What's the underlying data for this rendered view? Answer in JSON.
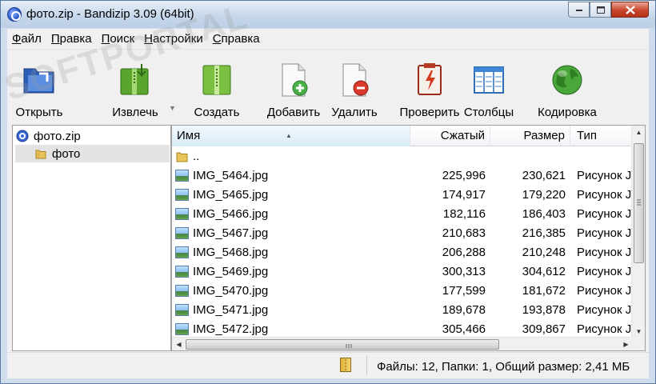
{
  "window": {
    "title": "фото.zip - Bandizip 3.09 (64bit)"
  },
  "menu": [
    "Файл",
    "Правка",
    "Поиск",
    "Настройки",
    "Справка"
  ],
  "toolbar": [
    {
      "label": "Открыть",
      "icon": "open-icon"
    },
    {
      "label": "Извлечь",
      "icon": "extract-icon"
    },
    {
      "label": "Создать",
      "icon": "create-icon"
    },
    {
      "label": "Добавить",
      "icon": "add-icon"
    },
    {
      "label": "Удалить",
      "icon": "delete-icon"
    },
    {
      "label": "Проверить",
      "icon": "test-icon"
    },
    {
      "label": "Столбцы",
      "icon": "columns-icon"
    },
    {
      "label": "Кодировка",
      "icon": "encoding-icon"
    }
  ],
  "tree": [
    {
      "label": "фото.zip",
      "icon": "archive-icon"
    },
    {
      "label": "фото",
      "icon": "folder-icon"
    }
  ],
  "columns": [
    "Имя",
    "Сжатый",
    "Размер",
    "Тип"
  ],
  "files": [
    {
      "name": "..",
      "compressed": "",
      "size": "",
      "type": ""
    },
    {
      "name": "IMG_5464.jpg",
      "compressed": "225,996",
      "size": "230,621",
      "type": "Рисунок JI"
    },
    {
      "name": "IMG_5465.jpg",
      "compressed": "174,917",
      "size": "179,220",
      "type": "Рисунок JI"
    },
    {
      "name": "IMG_5466.jpg",
      "compressed": "182,116",
      "size": "186,403",
      "type": "Рисунок JI"
    },
    {
      "name": "IMG_5467.jpg",
      "compressed": "210,683",
      "size": "216,385",
      "type": "Рисунок JI"
    },
    {
      "name": "IMG_5468.jpg",
      "compressed": "206,288",
      "size": "210,248",
      "type": "Рисунок JI"
    },
    {
      "name": "IMG_5469.jpg",
      "compressed": "300,313",
      "size": "304,612",
      "type": "Рисунок JI"
    },
    {
      "name": "IMG_5470.jpg",
      "compressed": "177,599",
      "size": "181,672",
      "type": "Рисунок JI"
    },
    {
      "name": "IMG_5471.jpg",
      "compressed": "189,678",
      "size": "193,878",
      "type": "Рисунок JI"
    },
    {
      "name": "IMG_5472.jpg",
      "compressed": "305,466",
      "size": "309,867",
      "type": "Рисунок JI"
    }
  ],
  "status": {
    "text": "Файлы: 12, Папки: 1, Общий размер: 2,41 МБ"
  },
  "watermark": "SOFTPORTAL"
}
